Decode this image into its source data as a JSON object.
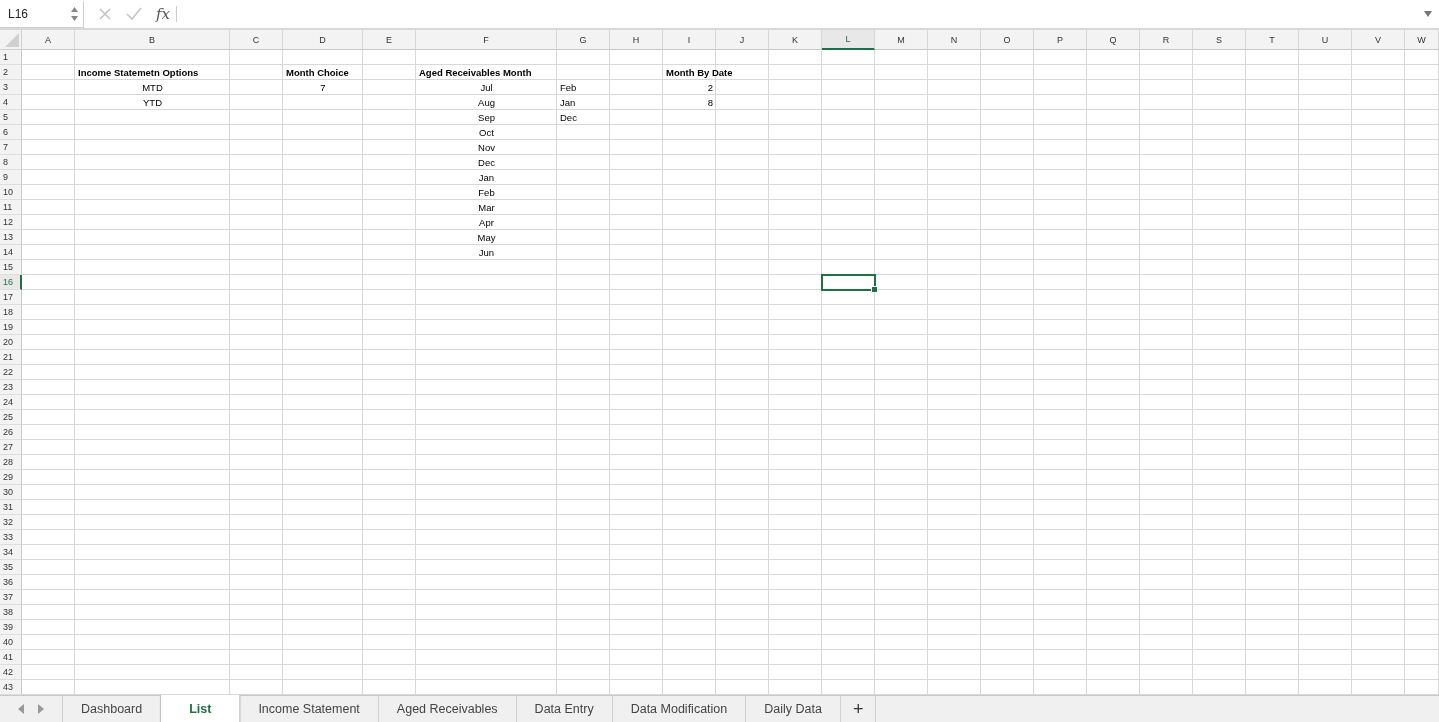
{
  "formula_bar": {
    "name_box": "L16",
    "function_label": "fx"
  },
  "columns": [
    {
      "label": "A",
      "selected": false
    },
    {
      "label": "B",
      "selected": false
    },
    {
      "label": "C",
      "selected": false
    },
    {
      "label": "D",
      "selected": false
    },
    {
      "label": "E",
      "selected": false
    },
    {
      "label": "F",
      "selected": false
    },
    {
      "label": "G",
      "selected": false
    },
    {
      "label": "H",
      "selected": false
    },
    {
      "label": "I",
      "selected": false
    },
    {
      "label": "J",
      "selected": false
    },
    {
      "label": "K",
      "selected": false
    },
    {
      "label": "L",
      "selected": true
    },
    {
      "label": "M",
      "selected": false
    },
    {
      "label": "N",
      "selected": false
    },
    {
      "label": "O",
      "selected": false
    },
    {
      "label": "P",
      "selected": false
    },
    {
      "label": "Q",
      "selected": false
    },
    {
      "label": "R",
      "selected": false
    },
    {
      "label": "S",
      "selected": false
    },
    {
      "label": "T",
      "selected": false
    },
    {
      "label": "U",
      "selected": false
    },
    {
      "label": "V",
      "selected": false
    },
    {
      "label": "W",
      "selected": false
    }
  ],
  "rows": [
    {
      "number": "1",
      "selected": false
    },
    {
      "number": "2",
      "selected": false,
      "cells": [
        {},
        {
          "text": "Income Statemetn Options",
          "kind": "heading"
        },
        {},
        {
          "text": "Month Choice",
          "kind": "heading"
        },
        {},
        {
          "text": "Aged Receivables Month",
          "kind": "heading"
        },
        {},
        {},
        {
          "text": "Month By Date",
          "kind": "heading"
        }
      ]
    },
    {
      "number": "3",
      "selected": false,
      "cells": [
        {},
        {
          "text": "MTD",
          "kind": "centered"
        },
        {},
        {
          "text": "7",
          "kind": "centered"
        },
        {},
        {
          "text": "Jul",
          "kind": "centered"
        },
        {
          "text": "Feb",
          "kind": "plain"
        },
        {},
        {
          "text": "2",
          "kind": "number"
        }
      ]
    },
    {
      "number": "4",
      "selected": false,
      "cells": [
        {},
        {
          "text": "YTD",
          "kind": "centered"
        },
        {},
        {},
        {},
        {
          "text": "Aug",
          "kind": "centered"
        },
        {
          "text": "Jan",
          "kind": "plain"
        },
        {},
        {
          "text": "8",
          "kind": "number"
        }
      ]
    },
    {
      "number": "5",
      "selected": false,
      "cells": [
        {},
        {},
        {},
        {},
        {},
        {
          "text": "Sep",
          "kind": "centered"
        },
        {
          "text": "Dec",
          "kind": "plain"
        }
      ]
    },
    {
      "number": "6",
      "selected": false,
      "cells": [
        {},
        {},
        {},
        {},
        {},
        {
          "text": "Oct",
          "kind": "centered"
        }
      ]
    },
    {
      "number": "7",
      "selected": false,
      "cells": [
        {},
        {},
        {},
        {},
        {},
        {
          "text": "Nov",
          "kind": "centered"
        }
      ]
    },
    {
      "number": "8",
      "selected": false,
      "cells": [
        {},
        {},
        {},
        {},
        {},
        {
          "text": "Dec",
          "kind": "centered"
        }
      ]
    },
    {
      "number": "9",
      "selected": false,
      "cells": [
        {},
        {},
        {},
        {},
        {},
        {
          "text": "Jan",
          "kind": "centered"
        }
      ]
    },
    {
      "number": "10",
      "selected": false,
      "cells": [
        {},
        {},
        {},
        {},
        {},
        {
          "text": "Feb",
          "kind": "centered"
        }
      ]
    },
    {
      "number": "11",
      "selected": false,
      "cells": [
        {},
        {},
        {},
        {},
        {},
        {
          "text": "Mar",
          "kind": "centered"
        }
      ]
    },
    {
      "number": "12",
      "selected": false,
      "cells": [
        {},
        {},
        {},
        {},
        {},
        {
          "text": "Apr",
          "kind": "centered"
        }
      ]
    },
    {
      "number": "13",
      "selected": false,
      "cells": [
        {},
        {},
        {},
        {},
        {},
        {
          "text": "May",
          "kind": "centered"
        }
      ]
    },
    {
      "number": "14",
      "selected": false,
      "cells": [
        {},
        {},
        {},
        {},
        {},
        {
          "text": "Jun",
          "kind": "centered"
        }
      ]
    },
    {
      "number": "15",
      "selected": false
    },
    {
      "number": "16",
      "selected": true
    },
    {
      "number": "17",
      "selected": false
    },
    {
      "number": "18",
      "selected": false
    },
    {
      "number": "19",
      "selected": false
    },
    {
      "number": "20",
      "selected": false
    },
    {
      "number": "21",
      "selected": false
    },
    {
      "number": "22",
      "selected": false
    },
    {
      "number": "23",
      "selected": false
    },
    {
      "number": "24",
      "selected": false
    },
    {
      "number": "25",
      "selected": false
    },
    {
      "number": "26",
      "selected": false
    },
    {
      "number": "27",
      "selected": false
    },
    {
      "number": "28",
      "selected": false
    },
    {
      "number": "29",
      "selected": false
    },
    {
      "number": "30",
      "selected": false
    },
    {
      "number": "31",
      "selected": false
    },
    {
      "number": "32",
      "selected": false
    },
    {
      "number": "33",
      "selected": false
    },
    {
      "number": "34",
      "selected": false
    },
    {
      "number": "35",
      "selected": false
    },
    {
      "number": "36",
      "selected": false
    },
    {
      "number": "37",
      "selected": false
    },
    {
      "number": "38",
      "selected": false
    },
    {
      "number": "39",
      "selected": false
    },
    {
      "number": "40",
      "selected": false
    },
    {
      "number": "41",
      "selected": false
    },
    {
      "number": "42",
      "selected": false
    },
    {
      "number": "43",
      "selected": false
    }
  ],
  "sheet_tabs": [
    {
      "label": "Dashboard",
      "selected": false
    },
    {
      "label": "List",
      "selected": true
    },
    {
      "label": "Income Statement",
      "selected": false
    },
    {
      "label": "Aged Receivables",
      "selected": false
    },
    {
      "label": "Data Entry",
      "selected": false
    },
    {
      "label": "Data Modification",
      "selected": false
    },
    {
      "label": "Daily Data",
      "selected": false
    }
  ],
  "add_sheet": "+"
}
